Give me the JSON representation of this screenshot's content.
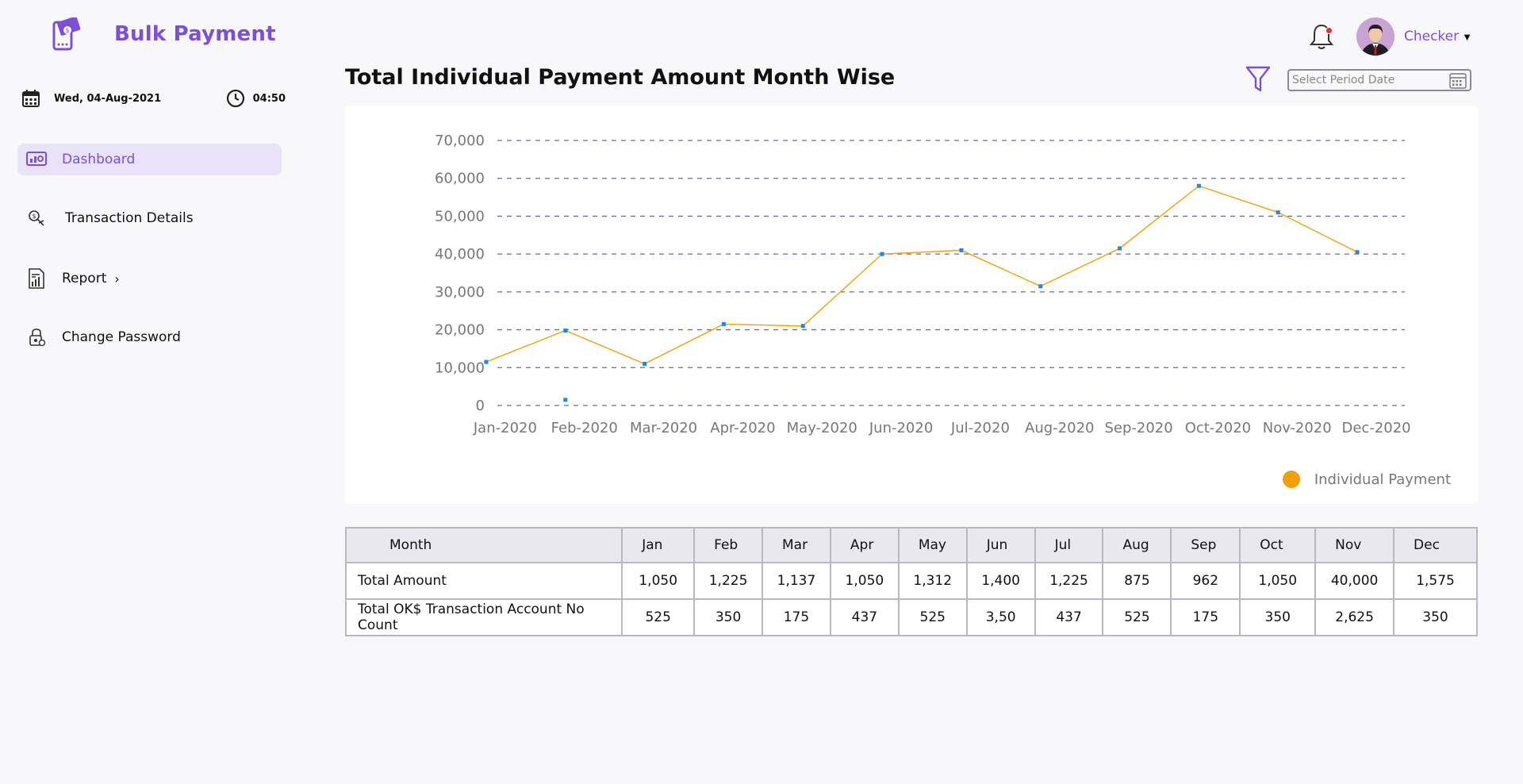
{
  "header": {
    "brand_title": "Bulk Payment",
    "user_name": "Checker",
    "notification_icon": "bell-icon",
    "avatar_icon": "user-avatar"
  },
  "sidebar": {
    "date": "Wed, 04-Aug-2021",
    "time": "04:50",
    "items": [
      {
        "label": "Dashboard",
        "icon": "dashboard-icon",
        "active": true
      },
      {
        "label": "Transaction Details",
        "icon": "transaction-icon",
        "active": false
      },
      {
        "label": "Report",
        "icon": "report-icon",
        "active": false,
        "has_submenu": true
      },
      {
        "label": "Change Password",
        "icon": "lock-icon",
        "active": false
      }
    ]
  },
  "main": {
    "title": "Total Individual Payment Amount Month Wise",
    "period_placeholder": "Select Period Date"
  },
  "colors": {
    "accent": "#7b4fd8",
    "line": "#f29f05",
    "point": "#1e88e5",
    "grid": "#6a6d8f"
  },
  "chart_data": {
    "type": "line",
    "categories": [
      "Jan-2020",
      "Feb-2020",
      "Mar-2020",
      "Apr-2020",
      "May-2020",
      "Jun-2020",
      "Jul-2020",
      "Aug-2020",
      "Sep-2020",
      "Oct-2020",
      "Nov-2020",
      "Dec-2020"
    ],
    "series": [
      {
        "name": "Individual Payment",
        "values": [
          11500,
          19800,
          11000,
          21500,
          21000,
          40000,
          41000,
          31500,
          41500,
          58000,
          51000,
          40500
        ]
      }
    ],
    "stray_point": {
      "category": "Feb-2020",
      "value": 1500
    },
    "yticks": [
      "0",
      "10,000",
      "20,000",
      "30,000",
      "40,000",
      "50,000",
      "60,000",
      "70,000"
    ],
    "ylim": [
      0,
      70000
    ],
    "grid": true,
    "legend_position": "bottom-right"
  },
  "table": {
    "headers": [
      "Month",
      "Jan",
      "Feb",
      "Mar",
      "Apr",
      "May",
      "Jun",
      "Jul",
      "Aug",
      "Sep",
      "Oct",
      "Nov",
      "Dec"
    ],
    "rows": [
      [
        "Total Amount",
        "1,050",
        "1,225",
        "1,137",
        "1,050",
        "1,312",
        "1,400",
        "1,225",
        "875",
        "962",
        "1,050",
        "40,000",
        "1,575"
      ],
      [
        "Total OK$ Transaction Account No Count",
        "525",
        "350",
        "175",
        "437",
        "525",
        "3,50",
        "437",
        "525",
        "175",
        "350",
        "2,625",
        "350"
      ]
    ]
  }
}
